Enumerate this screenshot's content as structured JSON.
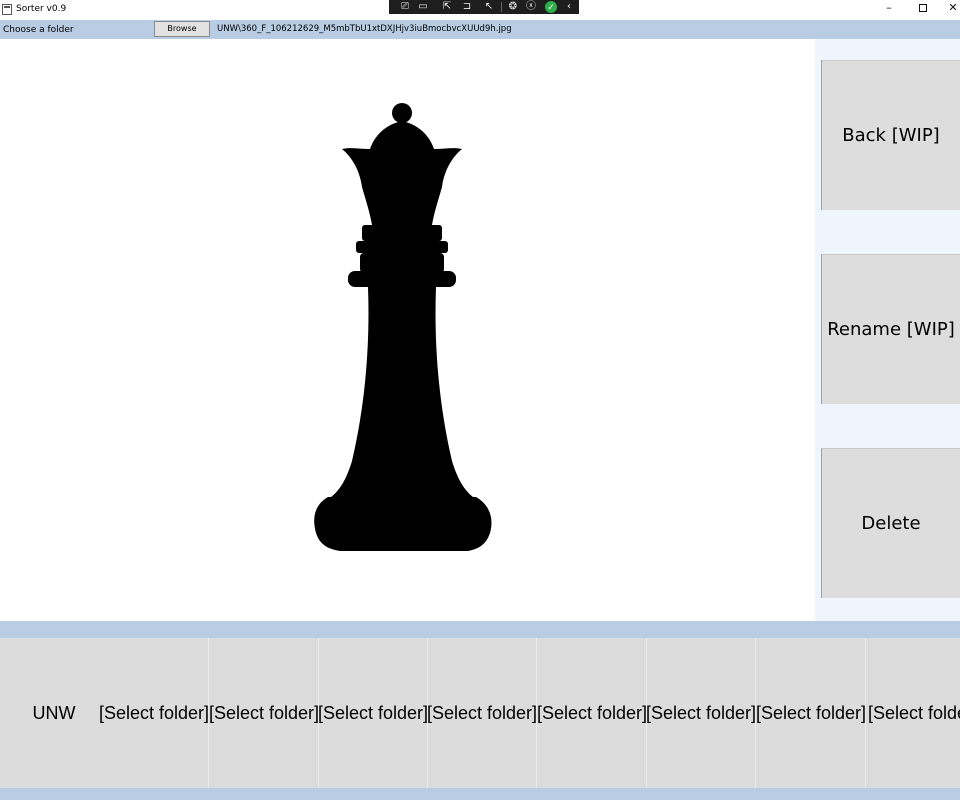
{
  "window": {
    "title": "Sorter v0.9",
    "minimize_glyph": "–",
    "close_glyph": "✕"
  },
  "caption_toolbar": {
    "icons": [
      "frame-icon",
      "video-icon",
      "select-icon",
      "window-icon",
      "cursor-icon",
      "network-icon",
      "close-circle-icon",
      "checkmark-icon",
      "chevron-left-icon"
    ],
    "glyphs": [
      "⎚",
      "▭",
      "⇱",
      "⊐",
      "↖",
      "❂",
      "ⓧ",
      "✓",
      "‹"
    ]
  },
  "pathbar": {
    "choose_label": "Choose a folder",
    "browse_label": "Browse",
    "path": "UNW\\360_F_106212629_M5mbTbU1xtDXJHjv3iuBmocbvcXUUd9h.jpg"
  },
  "image": {
    "name": "chess-queen-image",
    "fill": "#000000"
  },
  "sidebar": {
    "back_label": "Back [WIP]",
    "rename_label": "Rename [WIP]",
    "delete_label": "Delete"
  },
  "folders": [
    "UNW",
    "[Select folder]",
    "[Select folder]",
    "[Select folder]",
    "[Select folder]",
    "[Select folder]",
    "[Select folder]",
    "[Select folder]",
    "[Select folder]"
  ],
  "colors": {
    "accent_bar": "#b8cce4",
    "button_bg": "#dddddd",
    "sidebar_bg": "#eef5fc",
    "toolbar_ok": "#2eaf4a"
  }
}
